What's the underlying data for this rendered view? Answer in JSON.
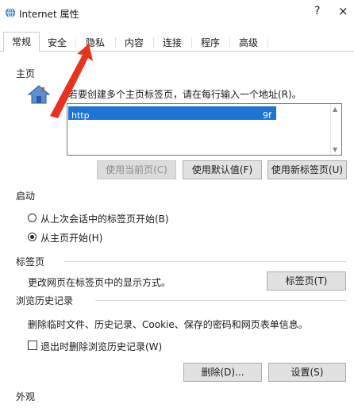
{
  "window": {
    "title": "Internet 属性",
    "help": "?",
    "close": "×"
  },
  "tabs": [
    "常规",
    "安全",
    "隐私",
    "内容",
    "连接",
    "程序",
    "高级"
  ],
  "home": {
    "group_label": "主页",
    "instruction": "若要创建多个主页标签页，请在每行输入一个地址(R)。",
    "url_start": "http",
    "url_end": "9f",
    "buttons": {
      "current": "使用当前页(C)",
      "default": "使用默认值(F)",
      "new_tab": "使用新标签页(U)"
    }
  },
  "startup": {
    "group_label": "启动",
    "option1": "从上次会话中的标签页开始(B)",
    "option2": "从主页开始(H)",
    "selected": "option2"
  },
  "tabs_group": {
    "group_label": "标签页",
    "description": "更改网页在标签页中的显示方式。",
    "button": "标签页(T)"
  },
  "history": {
    "group_label": "浏览历史记录",
    "description": "删除临时文件、历史记录、Cookie、保存的密码和网页表单信息。",
    "checkbox_label": "退出时删除浏览历史记录(W)",
    "delete_button": "删除(D)...",
    "settings_button": "设置(S)"
  },
  "appearance": {
    "group_label": "外观"
  },
  "colors": {
    "selection": "#1e73d6",
    "arrow": "#e8321e"
  }
}
